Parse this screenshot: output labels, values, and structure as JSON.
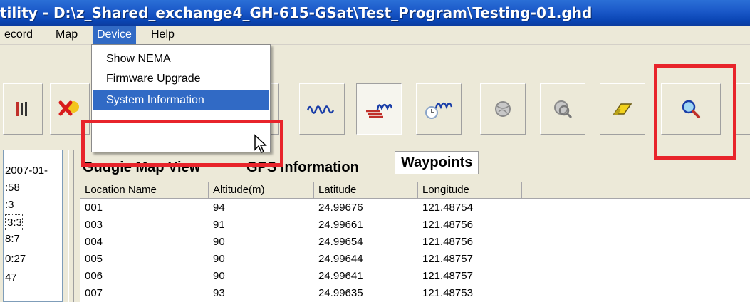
{
  "window": {
    "title": "tility - D:\\z_Shared_exchange4_GH-615-GSat\\Test_Program\\Testing-01.ghd"
  },
  "menu": {
    "items": [
      "ecord",
      "Map",
      "Device",
      "Help"
    ],
    "active": "Device"
  },
  "device_menu": {
    "items": [
      "Show NEMA",
      "Firmware Upgrade",
      "System Information"
    ],
    "highlighted": "System Information"
  },
  "toolbar": {
    "buttons": [
      "track-bars-icon",
      "delete-icon",
      "waveform-icon",
      "track-upload-icon",
      "track-clock-icon",
      "globe-icon",
      "globe-search-icon",
      "eraser-icon",
      "magnifier-icon"
    ],
    "pressed": "track-upload-icon"
  },
  "left_panel": {
    "rows": [
      "2007-01-",
      ":58",
      ":3",
      "3:3",
      "8:7",
      "0:27",
      "47"
    ]
  },
  "tabs": {
    "items": [
      "Guugie Map View",
      "GPS Information",
      "Waypoints"
    ],
    "active": "Waypoints"
  },
  "waypoints_table": {
    "columns": [
      "Location Name",
      "Altitude(m)",
      "Latitude",
      "Longitude"
    ],
    "rows": [
      [
        "001",
        "94",
        "24.99676",
        "121.48754"
      ],
      [
        "003",
        "91",
        "24.99661",
        "121.48756"
      ],
      [
        "004",
        "90",
        "24.99654",
        "121.48756"
      ],
      [
        "005",
        "90",
        "24.99644",
        "121.48757"
      ],
      [
        "006",
        "90",
        "24.99641",
        "121.48757"
      ],
      [
        "007",
        "93",
        "24.99635",
        "121.48753"
      ]
    ]
  },
  "colors": {
    "title_bar": "#0a45b4",
    "menu_highlight": "#316ac5",
    "annotation_red": "#e8242b",
    "window_bg": "#ece9d8"
  }
}
